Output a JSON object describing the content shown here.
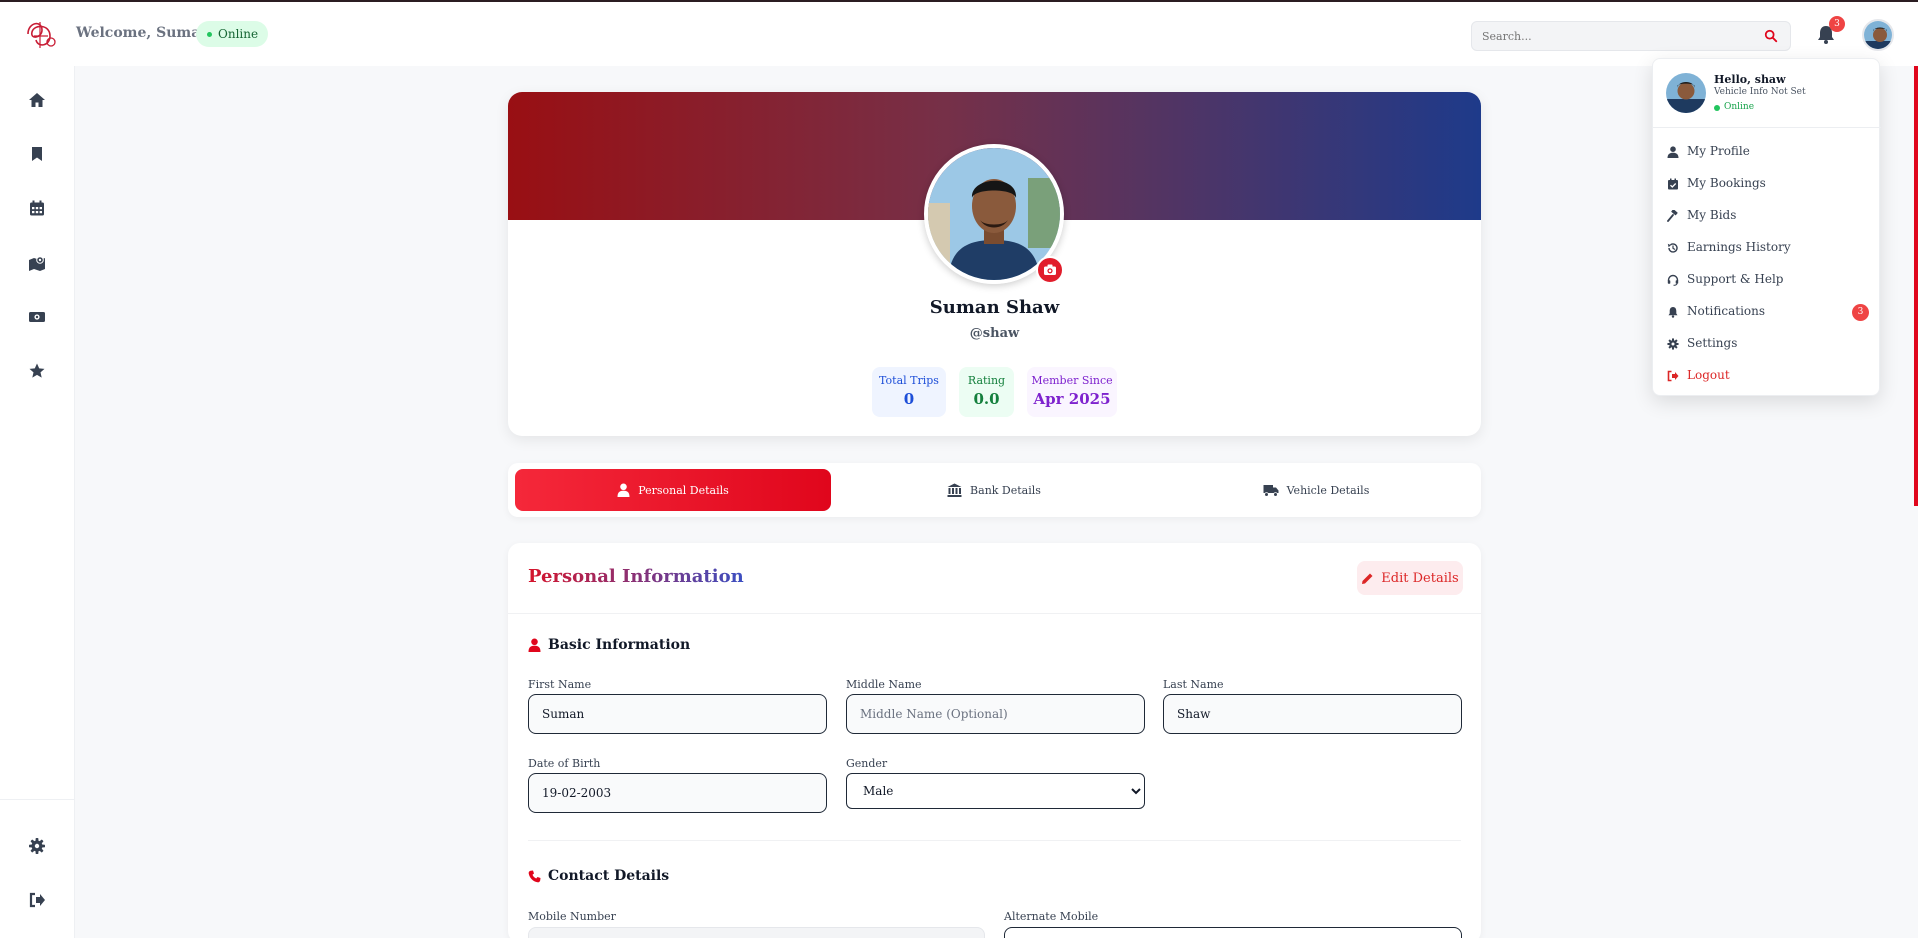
{
  "header": {
    "welcome": "Welcome, Suman",
    "status": "Online",
    "search_placeholder": "Search...",
    "notification_count": "3"
  },
  "sidebar": {
    "items": [
      "home-icon",
      "bookmark-icon",
      "calendar-icon",
      "map-icon",
      "money-icon",
      "star-icon"
    ],
    "bottom_items": [
      "settings-icon",
      "logout-icon"
    ]
  },
  "profile": {
    "name": "Suman Shaw",
    "username": "@shaw",
    "stats": [
      {
        "label": "Total Trips",
        "value": "0",
        "color": "#1d4ed8",
        "bg": "#eff4ff"
      },
      {
        "label": "Rating",
        "value": "0.0",
        "color": "#15803d",
        "bg": "#ecfdf3"
      },
      {
        "label": "Member Since",
        "value": "Apr 2025",
        "color": "#7e22ce",
        "bg": "#faf5ff"
      }
    ]
  },
  "tabs": [
    "Personal Details",
    "Bank Details",
    "Vehicle Details"
  ],
  "personal": {
    "title": "Personal Information",
    "edit_label": "Edit Details",
    "basic_title": "Basic Information",
    "first_name_label": "First Name",
    "first_name": "Suman",
    "middle_name_label": "Middle Name",
    "middle_name_placeholder": "Middle Name (Optional)",
    "last_name_label": "Last Name",
    "last_name": "Shaw",
    "dob_label": "Date of Birth",
    "dob": "19-02-2003",
    "gender_label": "Gender",
    "gender": "Male",
    "contact_title": "Contact Details",
    "mobile_label": "Mobile Number",
    "alt_mobile_label": "Alternate Mobile"
  },
  "menu": {
    "hello": "Hello, shaw",
    "vehicle": "Vehicle Info Not Set",
    "status": "Online",
    "items": [
      {
        "label": "My Profile",
        "icon": "user-icon"
      },
      {
        "label": "My Bookings",
        "icon": "calendar-check-icon"
      },
      {
        "label": "My Bids",
        "icon": "gavel-icon"
      },
      {
        "label": "Earnings History",
        "icon": "history-icon"
      },
      {
        "label": "Support & Help",
        "icon": "headset-icon"
      },
      {
        "label": "Notifications",
        "icon": "bell-icon",
        "badge": "3"
      },
      {
        "label": "Settings",
        "icon": "gear-icon"
      },
      {
        "label": "Logout",
        "icon": "sign-out-icon"
      }
    ]
  },
  "colors": {
    "accent": "#e0061c",
    "banner_start": "#990f13",
    "banner_end": "#1e3a8a"
  }
}
